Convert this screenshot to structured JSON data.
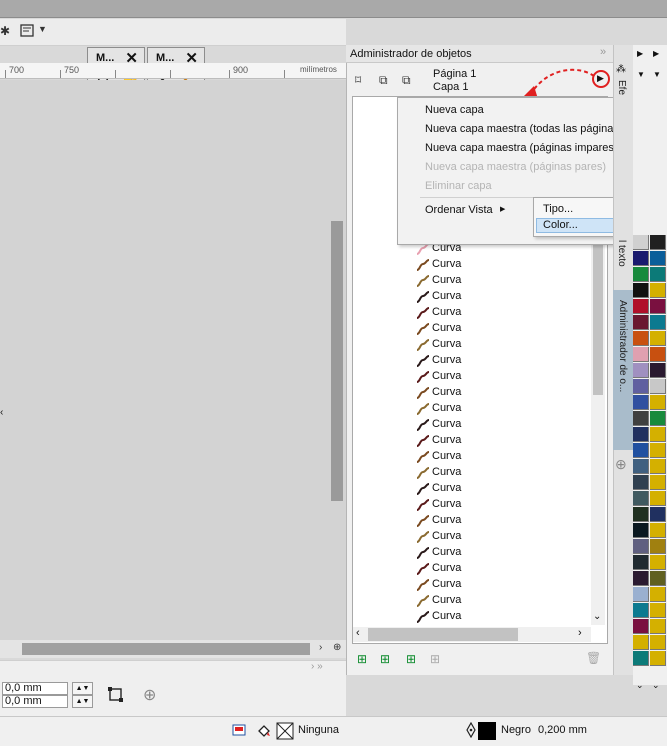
{
  "toolbar": {
    "layout_icon": "page-layout-icon",
    "dropdown_icon": "caret-down-icon"
  },
  "mini_panels": [
    {
      "title": "M...",
      "close": "✕",
      "tools": [
        "zoom-icon",
        "hand-pan-icon"
      ]
    },
    {
      "title": "M...",
      "close": "✕",
      "tools": [
        "eyedropper-icon",
        "paintbucket-dropper-icon"
      ]
    }
  ],
  "ruler": {
    "labels": [
      "700",
      "750",
      "900"
    ],
    "unit": "milímetros"
  },
  "panel": {
    "title": "Administrador de objetos",
    "page_label": "Página 1",
    "layer_label": "Capa 1"
  },
  "context_menu": {
    "items": [
      {
        "label": "Nueva capa",
        "enabled": true
      },
      {
        "label": "Nueva capa maestra (todas las páginas)",
        "enabled": true
      },
      {
        "label": "Nueva capa maestra (páginas impares)",
        "enabled": true
      },
      {
        "label": "Nueva capa maestra (páginas pares)",
        "enabled": false
      },
      {
        "label": "Eliminar capa",
        "enabled": false
      },
      {
        "label": "Ordenar Vista",
        "enabled": true,
        "has_submenu": true
      }
    ],
    "submenu": [
      {
        "label": "Tipo..."
      },
      {
        "label": "Color..."
      }
    ]
  },
  "tree": {
    "item_label": "Curva",
    "count": 24
  },
  "side_tabs": {
    "top_tab": "Efe",
    "text_tab": "l texto",
    "objects_tab": "Administrador de o..."
  },
  "bottombar": {
    "x_value": "0,0 mm",
    "y_value": "0,0 mm"
  },
  "statusbar": {
    "fill_label": "Ninguna",
    "outline_color_label": "Negro",
    "outline_width": "0,200 mm"
  },
  "colors": {
    "accent_red": "#e02020",
    "palette": [
      "#c8c8c8",
      "#202020",
      "#1a1a6e",
      "#0a5e9a",
      "#188a3c",
      "#0c7a78",
      "#111111",
      "#d4b000",
      "#b0102a",
      "#7a1040",
      "#0c7a90",
      "#c85010",
      "#6a1830",
      "#e0a0b0",
      "#2a1a30",
      "#a090c0",
      "#9ab0d0",
      "#6060a0",
      "#3050a0",
      "#404040",
      "#202020",
      "#203060",
      "#606080",
      "#2050a0",
      "#406080",
      "#304050",
      "#202a30",
      "#405a60",
      "#203020",
      "#0a1820"
    ]
  }
}
